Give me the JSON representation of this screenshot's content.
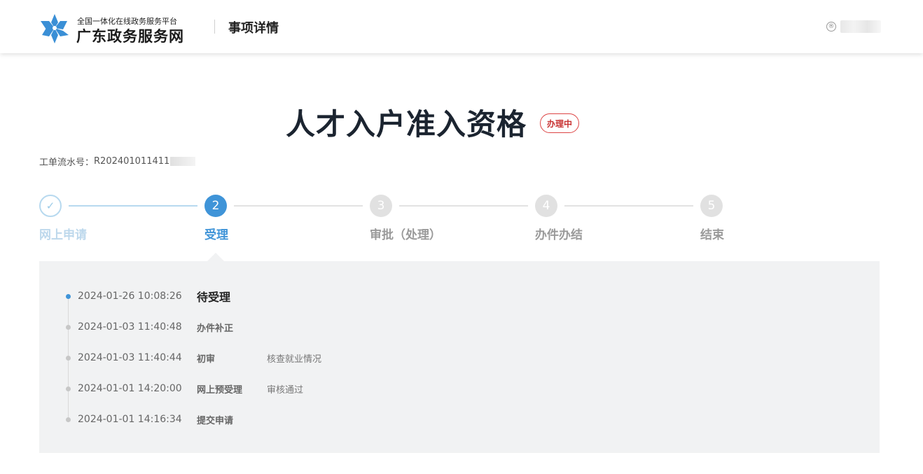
{
  "header": {
    "brand_sub": "全国一体化在线政务服务平台",
    "brand_main": "广东政务服务网",
    "page_title": "事项详情",
    "user_icon_glyph": "®"
  },
  "title": "人才入户准入资格",
  "status_badge": "办理中",
  "serial": {
    "label": "工单流水号：",
    "value": "R202401011411"
  },
  "steps": [
    {
      "number": "✓",
      "label": "网上申请",
      "state": "done"
    },
    {
      "number": "2",
      "label": "受理",
      "state": "active"
    },
    {
      "number": "3",
      "label": "审批（处理）",
      "state": "pending"
    },
    {
      "number": "4",
      "label": "办件办结",
      "state": "pending"
    },
    {
      "number": "5",
      "label": "结束",
      "state": "pending"
    }
  ],
  "timeline": [
    {
      "time": "2024-01-26 10:08:26",
      "status": "待受理",
      "note": ""
    },
    {
      "time": "2024-01-03 11:40:48",
      "status": "办件补正",
      "note": ""
    },
    {
      "time": "2024-01-03 11:40:44",
      "status": "初审",
      "note": "核查就业情况"
    },
    {
      "time": "2024-01-01 14:20:00",
      "status": "网上预受理",
      "note": "审核通过"
    },
    {
      "time": "2024-01-01 14:16:34",
      "status": "提交申请",
      "note": ""
    }
  ],
  "colors": {
    "accent": "#3f94d8",
    "badge": "#c83232",
    "panel": "#f1f2f3"
  }
}
